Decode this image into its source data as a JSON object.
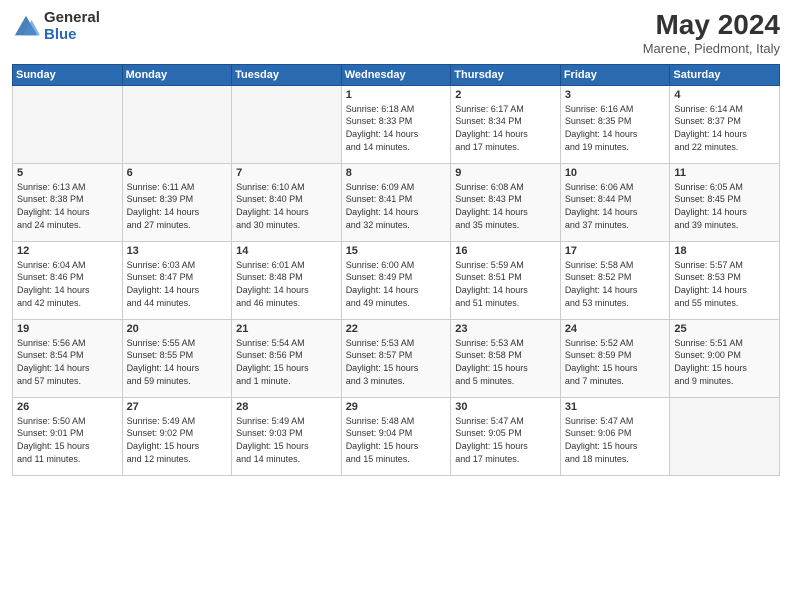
{
  "header": {
    "logo_general": "General",
    "logo_blue": "Blue",
    "month_year": "May 2024",
    "location": "Marene, Piedmont, Italy"
  },
  "weekdays": [
    "Sunday",
    "Monday",
    "Tuesday",
    "Wednesday",
    "Thursday",
    "Friday",
    "Saturday"
  ],
  "weeks": [
    [
      {
        "day": "",
        "info": ""
      },
      {
        "day": "",
        "info": ""
      },
      {
        "day": "",
        "info": ""
      },
      {
        "day": "1",
        "info": "Sunrise: 6:18 AM\nSunset: 8:33 PM\nDaylight: 14 hours\nand 14 minutes."
      },
      {
        "day": "2",
        "info": "Sunrise: 6:17 AM\nSunset: 8:34 PM\nDaylight: 14 hours\nand 17 minutes."
      },
      {
        "day": "3",
        "info": "Sunrise: 6:16 AM\nSunset: 8:35 PM\nDaylight: 14 hours\nand 19 minutes."
      },
      {
        "day": "4",
        "info": "Sunrise: 6:14 AM\nSunset: 8:37 PM\nDaylight: 14 hours\nand 22 minutes."
      }
    ],
    [
      {
        "day": "5",
        "info": "Sunrise: 6:13 AM\nSunset: 8:38 PM\nDaylight: 14 hours\nand 24 minutes."
      },
      {
        "day": "6",
        "info": "Sunrise: 6:11 AM\nSunset: 8:39 PM\nDaylight: 14 hours\nand 27 minutes."
      },
      {
        "day": "7",
        "info": "Sunrise: 6:10 AM\nSunset: 8:40 PM\nDaylight: 14 hours\nand 30 minutes."
      },
      {
        "day": "8",
        "info": "Sunrise: 6:09 AM\nSunset: 8:41 PM\nDaylight: 14 hours\nand 32 minutes."
      },
      {
        "day": "9",
        "info": "Sunrise: 6:08 AM\nSunset: 8:43 PM\nDaylight: 14 hours\nand 35 minutes."
      },
      {
        "day": "10",
        "info": "Sunrise: 6:06 AM\nSunset: 8:44 PM\nDaylight: 14 hours\nand 37 minutes."
      },
      {
        "day": "11",
        "info": "Sunrise: 6:05 AM\nSunset: 8:45 PM\nDaylight: 14 hours\nand 39 minutes."
      }
    ],
    [
      {
        "day": "12",
        "info": "Sunrise: 6:04 AM\nSunset: 8:46 PM\nDaylight: 14 hours\nand 42 minutes."
      },
      {
        "day": "13",
        "info": "Sunrise: 6:03 AM\nSunset: 8:47 PM\nDaylight: 14 hours\nand 44 minutes."
      },
      {
        "day": "14",
        "info": "Sunrise: 6:01 AM\nSunset: 8:48 PM\nDaylight: 14 hours\nand 46 minutes."
      },
      {
        "day": "15",
        "info": "Sunrise: 6:00 AM\nSunset: 8:49 PM\nDaylight: 14 hours\nand 49 minutes."
      },
      {
        "day": "16",
        "info": "Sunrise: 5:59 AM\nSunset: 8:51 PM\nDaylight: 14 hours\nand 51 minutes."
      },
      {
        "day": "17",
        "info": "Sunrise: 5:58 AM\nSunset: 8:52 PM\nDaylight: 14 hours\nand 53 minutes."
      },
      {
        "day": "18",
        "info": "Sunrise: 5:57 AM\nSunset: 8:53 PM\nDaylight: 14 hours\nand 55 minutes."
      }
    ],
    [
      {
        "day": "19",
        "info": "Sunrise: 5:56 AM\nSunset: 8:54 PM\nDaylight: 14 hours\nand 57 minutes."
      },
      {
        "day": "20",
        "info": "Sunrise: 5:55 AM\nSunset: 8:55 PM\nDaylight: 14 hours\nand 59 minutes."
      },
      {
        "day": "21",
        "info": "Sunrise: 5:54 AM\nSunset: 8:56 PM\nDaylight: 15 hours\nand 1 minute."
      },
      {
        "day": "22",
        "info": "Sunrise: 5:53 AM\nSunset: 8:57 PM\nDaylight: 15 hours\nand 3 minutes."
      },
      {
        "day": "23",
        "info": "Sunrise: 5:53 AM\nSunset: 8:58 PM\nDaylight: 15 hours\nand 5 minutes."
      },
      {
        "day": "24",
        "info": "Sunrise: 5:52 AM\nSunset: 8:59 PM\nDaylight: 15 hours\nand 7 minutes."
      },
      {
        "day": "25",
        "info": "Sunrise: 5:51 AM\nSunset: 9:00 PM\nDaylight: 15 hours\nand 9 minutes."
      }
    ],
    [
      {
        "day": "26",
        "info": "Sunrise: 5:50 AM\nSunset: 9:01 PM\nDaylight: 15 hours\nand 11 minutes."
      },
      {
        "day": "27",
        "info": "Sunrise: 5:49 AM\nSunset: 9:02 PM\nDaylight: 15 hours\nand 12 minutes."
      },
      {
        "day": "28",
        "info": "Sunrise: 5:49 AM\nSunset: 9:03 PM\nDaylight: 15 hours\nand 14 minutes."
      },
      {
        "day": "29",
        "info": "Sunrise: 5:48 AM\nSunset: 9:04 PM\nDaylight: 15 hours\nand 15 minutes."
      },
      {
        "day": "30",
        "info": "Sunrise: 5:47 AM\nSunset: 9:05 PM\nDaylight: 15 hours\nand 17 minutes."
      },
      {
        "day": "31",
        "info": "Sunrise: 5:47 AM\nSunset: 9:06 PM\nDaylight: 15 hours\nand 18 minutes."
      },
      {
        "day": "",
        "info": ""
      }
    ]
  ]
}
